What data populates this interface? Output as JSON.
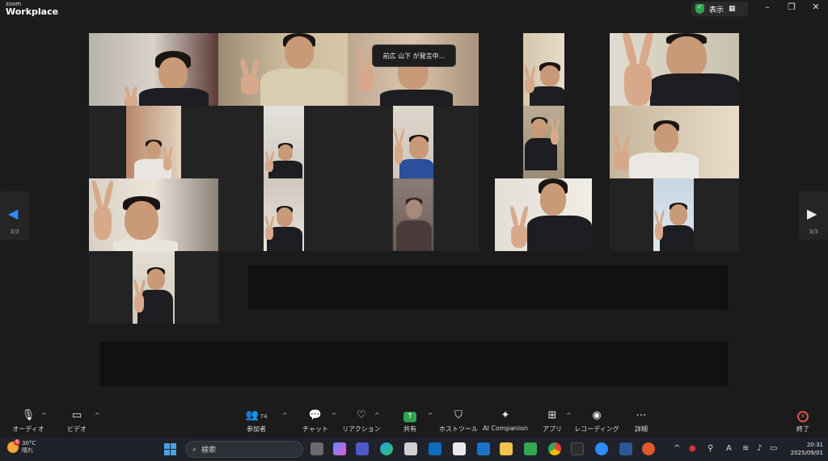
{
  "window": {
    "brand_small": "zoom",
    "brand_big": "Workplace",
    "view_label": "表示"
  },
  "banner": {
    "text": "前広 山下 が発言中..."
  },
  "pager": {
    "left": "3/3",
    "right": "3/3"
  },
  "toolbar": {
    "audio": "オーディオ",
    "video": "ビデオ",
    "participants": "参加者",
    "participant_count": "74",
    "chat": "チャット",
    "reactions": "リアクション",
    "share": "共有",
    "host_tools": "ホストツール",
    "ai_companion": "AI Companion",
    "apps": "アプリ",
    "recording": "レコーディング",
    "more": "詳細",
    "end": "終了"
  },
  "taskbar": {
    "weather_badge": "8",
    "temperature": "30°C",
    "condition": "晴れ",
    "search_placeholder": "検索",
    "time": "20:31",
    "date": "2025/09/01",
    "ime": "A"
  },
  "colors": {
    "accent_green": "#2ea44f",
    "end_red": "#e0504c",
    "background": "#1a1a1a"
  }
}
